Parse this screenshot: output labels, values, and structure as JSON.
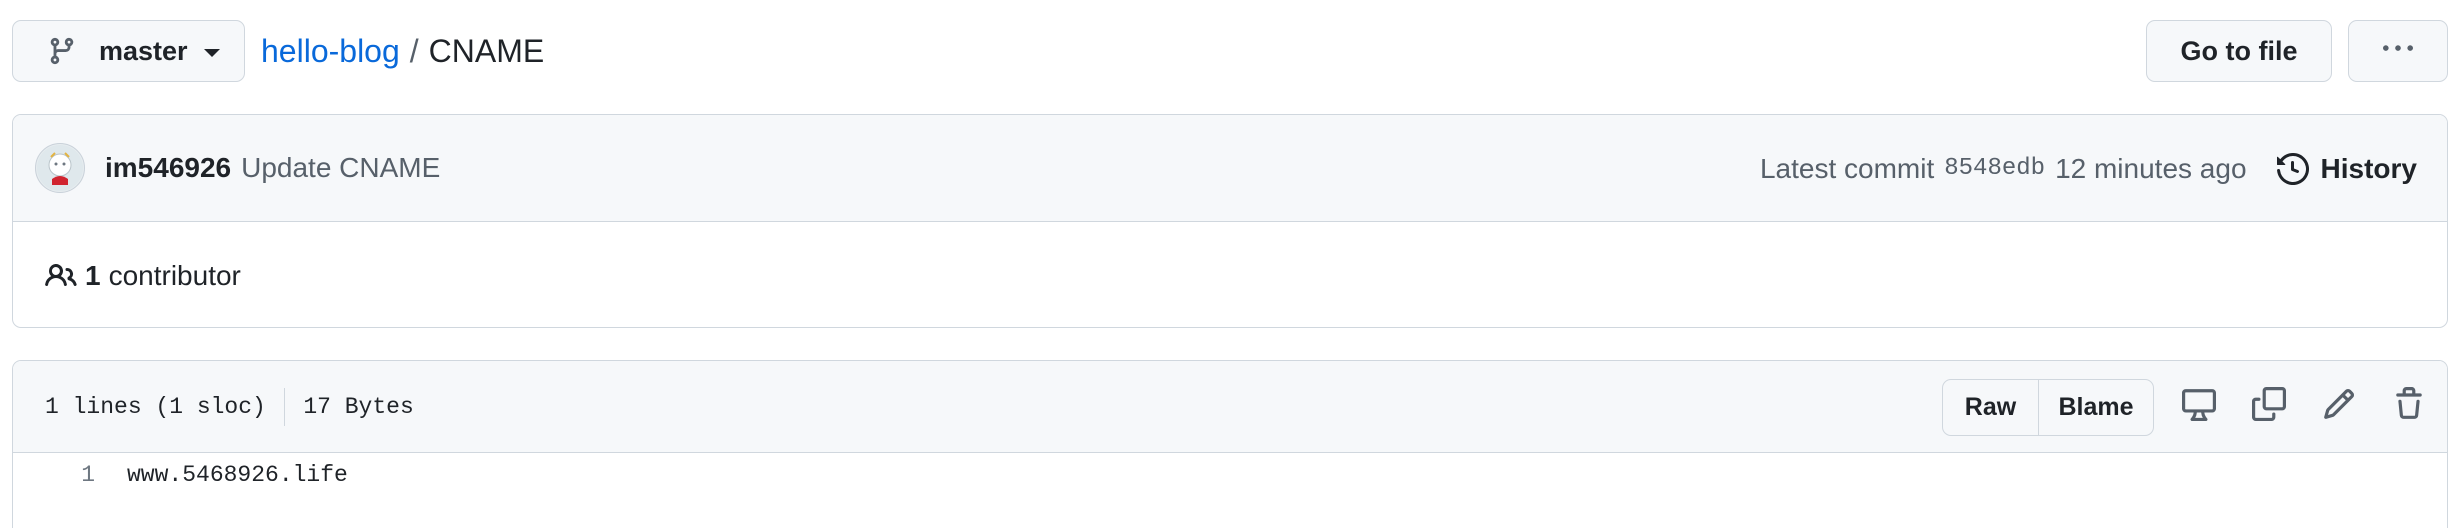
{
  "branch": {
    "name": "master",
    "icon": "git-branch-icon"
  },
  "breadcrumb": {
    "repo": "hello-blog",
    "separator": "/",
    "file": "CNAME"
  },
  "toolbar": {
    "goto_label": "Go to file",
    "more_icon": "kebab-horizontal-icon"
  },
  "commit": {
    "author": "im546926",
    "message": "Update CNAME",
    "latest_label": "Latest commit",
    "sha": "8548edb",
    "time": "12 minutes ago",
    "history_label": "History"
  },
  "contributors": {
    "count": "1",
    "label": "contributor"
  },
  "file": {
    "lines_info": "1 lines (1 sloc)",
    "size": "17 Bytes",
    "raw_label": "Raw",
    "blame_label": "Blame",
    "lines": [
      {
        "number": "1",
        "content": "www.5468926.life"
      }
    ]
  },
  "colors": {
    "link": "#0969da",
    "border": "#d0d7de",
    "header_bg": "#f6f8fa",
    "muted": "#57606a"
  }
}
